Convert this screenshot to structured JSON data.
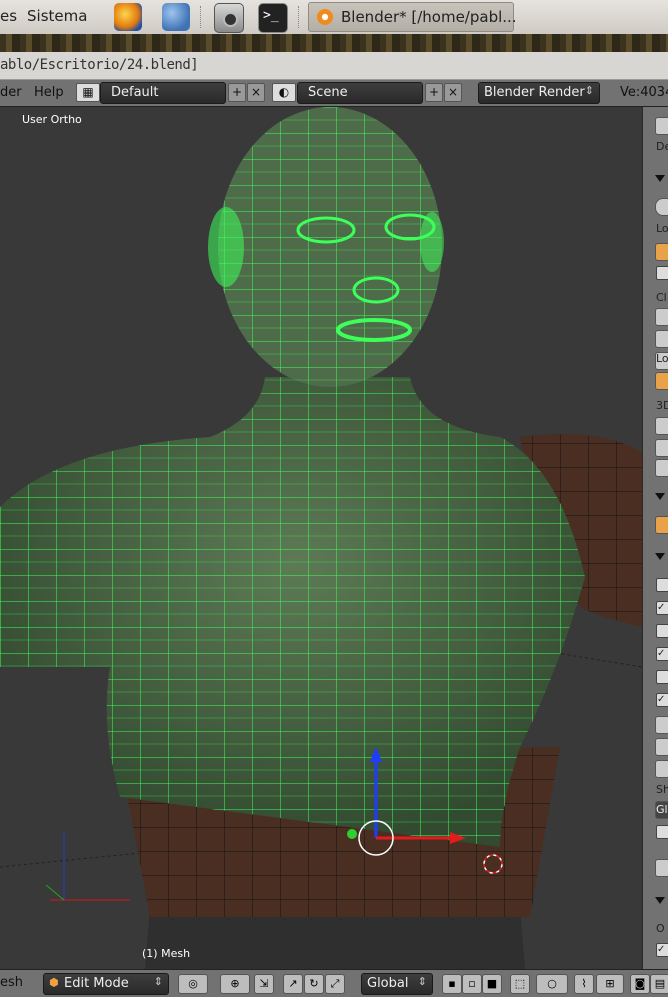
{
  "gnome_panel": {
    "menus": [
      "es",
      "Sistema"
    ],
    "launchers": [
      "firefox-icon",
      "users-icon",
      "camera-icon",
      "terminal-icon"
    ],
    "task_title": "Blender* [/home/pabl..."
  },
  "filepath": "ablo/Escritorio/24.blend]",
  "info_header": {
    "menus": [
      "der",
      "Help"
    ],
    "screen_layout": "Default",
    "scene": "Scene",
    "render_engine": "Blender Render",
    "version": "Ve:4034"
  },
  "viewport": {
    "view_label": "User Ortho",
    "object_label": "(1) Mesh"
  },
  "properties_panel": {
    "fragments": [
      "De",
      "Lo",
      "Cl",
      "Lo",
      "3D",
      "Sh",
      "Gl",
      "O"
    ]
  },
  "view3d_header": {
    "menu": "esh",
    "mode": "Edit Mode",
    "orientation": "Global"
  },
  "colors": {
    "wire": "#3dff5a",
    "skin": "#4a2e22",
    "header_gray": "#727272",
    "viewport_bg": "#393939"
  }
}
